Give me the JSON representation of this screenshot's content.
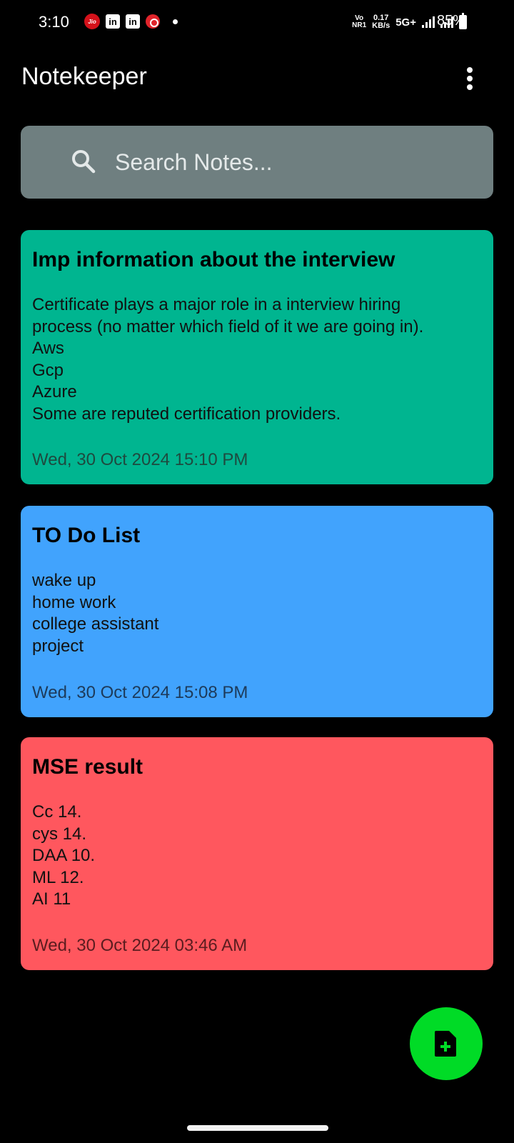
{
  "status_bar": {
    "time": "3:10",
    "jio_label": "Jio",
    "linkedin_label": "in",
    "volte_top": "Vo",
    "volte_bottom": "NR1",
    "speed_value": "0.17",
    "speed_unit": "KB/s",
    "network": "5G+",
    "battery": "85%"
  },
  "app_bar": {
    "title": "Notekeeper",
    "overflow_icon": "more-vert-icon"
  },
  "search": {
    "placeholder": "Search Notes...",
    "value": "",
    "icon": "search-icon"
  },
  "notes": [
    {
      "title": "Imp information about the interview",
      "body": "Certificate plays a major role in a  interview hiring\nprocess (no matter which field of it we are going in).\nAws\nGcp\nAzure\nSome are reputed certification providers.",
      "date": "Wed, 30 Oct 2024 15:10 PM",
      "color": "#00b590"
    },
    {
      "title": "TO Do List",
      "body": "wake up\nhome work\ncollege assistant\nproject",
      "date": "Wed, 30 Oct 2024 15:08 PM",
      "color": "#41a3fd"
    },
    {
      "title": "MSE result",
      "body": "Cc 14.\ncys 14.\nDAA 10.\nML 12.\nAI 11",
      "date": "Wed, 30 Oct 2024 03:46 AM",
      "color": "#ff575e"
    }
  ],
  "fab": {
    "icon": "add-note-icon",
    "color": "#00db26"
  },
  "colors": {
    "background": "#000000",
    "search_bg": "#6f7f80"
  }
}
